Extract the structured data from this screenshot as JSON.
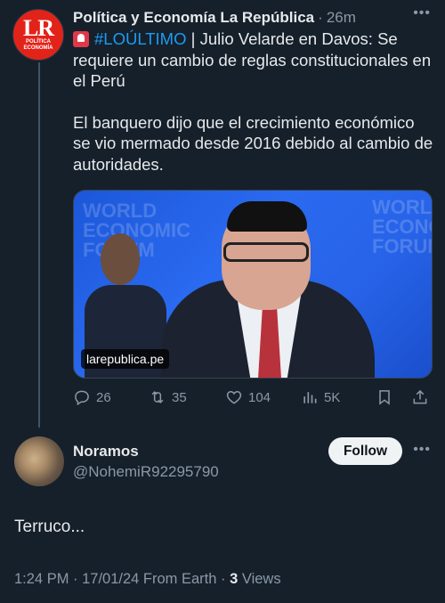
{
  "tweet": {
    "author_name": "Política y Economía La República",
    "time": "26m",
    "avatar": {
      "big": "LR",
      "line1": "POLÍTICA",
      "line2": "ECONOMÍA"
    },
    "hashtag": "#LOÚLTIMO",
    "headline": " | Julio Velarde en Davos: Se requiere un cambio de reglas constitucionales en el Perú",
    "paragraph2": "El banquero dijo que el crecimiento económico se vio mermado desde 2016 debido al cambio de autoridades.",
    "media_domain": "larepublica.pe",
    "stats": {
      "replies": "26",
      "retweets": "35",
      "likes": "104",
      "views": "5K"
    }
  },
  "reply": {
    "name": "Noramos",
    "handle": "@NohemiR92295790",
    "follow_label": "Follow",
    "text": "Terruco...",
    "meta_prefix": "1:24 PM · 17/01/24 From Earth · ",
    "views_count": "3",
    "views_label": " Views"
  },
  "icons": {
    "more": "more-icon",
    "reply": "reply-icon",
    "retweet": "retweet-icon",
    "like": "heart-icon",
    "views": "views-icon",
    "bookmark": "bookmark-icon",
    "share": "share-icon",
    "siren": "siren-icon"
  },
  "colors": {
    "background": "#15202b",
    "accent": "#1d9bf0",
    "muted": "#8b98a5"
  }
}
